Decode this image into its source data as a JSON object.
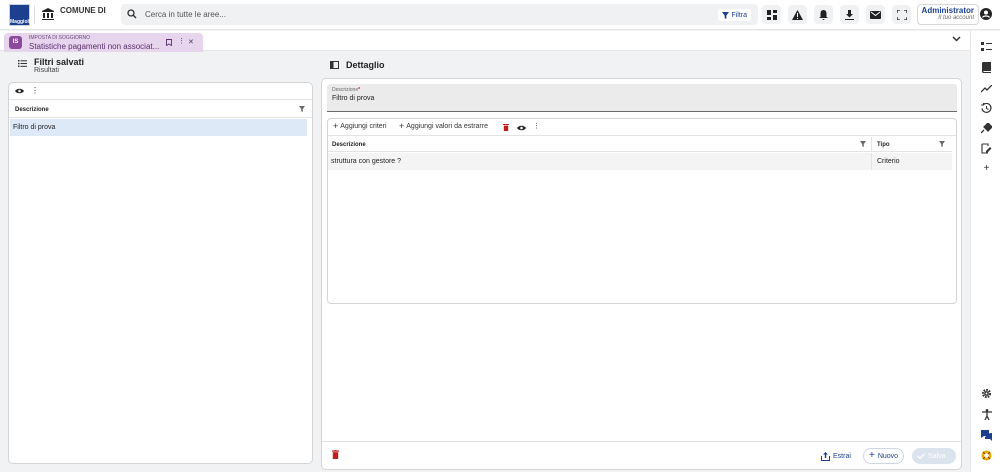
{
  "logo": {
    "brand": "Maggioli"
  },
  "header": {
    "comune": "COMUNE DI",
    "search_placeholder": "Cerca in tutte le aree...",
    "filter_label": "Filtra",
    "account_name": "Administrator",
    "account_sub": "Il tuo account"
  },
  "tab": {
    "badge": "IS",
    "category": "IMPOSTA DI SOGGIORNO",
    "title": "Statistiche pagamenti non associat..."
  },
  "left": {
    "title": "Filtri salvati",
    "subtitle": "Risultati",
    "column": "Descrizione",
    "rows": [
      "Filtro di prova"
    ]
  },
  "right": {
    "title": "Dettaglio",
    "desc_label": "Descrizione",
    "desc_required": "*",
    "desc_value": "Filtro di prova",
    "add_criteria": "Aggiungi criteri",
    "add_values": "Aggiungi valori da estrarre",
    "col_desc": "Descrizione",
    "col_type": "Tipo",
    "rows": [
      {
        "desc": "struttura con gestore ?",
        "type": "Criterio"
      }
    ]
  },
  "footer": {
    "extract": "Estrai",
    "new": "Nuovo",
    "save": "Salva"
  },
  "colors": {
    "brand": "#1c3f8f",
    "tab": "#e7d5ee",
    "selected_row": "#dde9f7",
    "danger": "#c21d1d"
  }
}
